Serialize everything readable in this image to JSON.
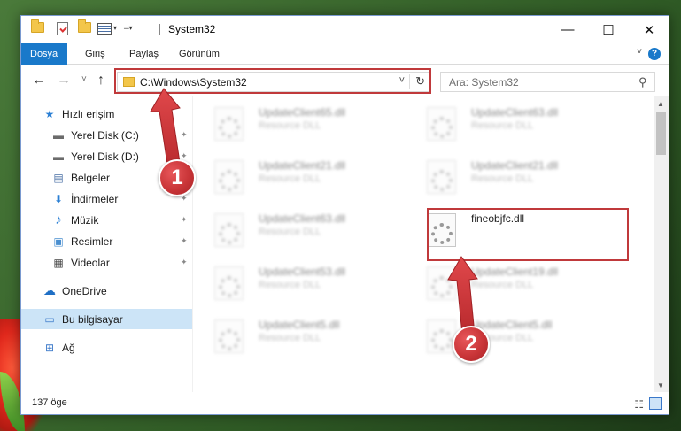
{
  "window": {
    "title": "System32",
    "minimize_glyph": "—",
    "maximize_glyph": "☐",
    "close_glyph": "✕"
  },
  "ribbon": {
    "tabs": [
      {
        "label": "Dosya",
        "active": true
      },
      {
        "label": "Giriş",
        "active": false
      },
      {
        "label": "Paylaş",
        "active": false
      },
      {
        "label": "Görünüm",
        "active": false
      }
    ],
    "help_glyph": "?"
  },
  "address": {
    "path": "C:\\Windows\\System32",
    "search_placeholder": "Ara: System32"
  },
  "sidebar": {
    "items": [
      {
        "label": "Hızlı erişim",
        "icon": "star-icon",
        "glyph": "★",
        "color": "#2a7fd4"
      },
      {
        "label": "Yerel Disk (C:)",
        "icon": "drive-icon",
        "glyph": "▬",
        "color": "#6b6b6b",
        "pinned": true
      },
      {
        "label": "Yerel Disk (D:)",
        "icon": "drive-icon",
        "glyph": "▬",
        "color": "#6b6b6b",
        "pinned": true
      },
      {
        "label": "Belgeler",
        "icon": "documents-icon",
        "glyph": "▤",
        "color": "#4a6fa5",
        "pinned": true
      },
      {
        "label": "İndirmeler",
        "icon": "downloads-icon",
        "glyph": "⬇",
        "color": "#2a7fd4",
        "pinned": true
      },
      {
        "label": "Müzik",
        "icon": "music-icon",
        "glyph": "♪",
        "color": "#2a7fd4",
        "pinned": true
      },
      {
        "label": "Resimler",
        "icon": "pictures-icon",
        "glyph": "▣",
        "color": "#4a8fd0",
        "pinned": true
      },
      {
        "label": "Videolar",
        "icon": "videos-icon",
        "glyph": "▦",
        "color": "#444444",
        "pinned": true
      },
      {
        "label": "OneDrive",
        "icon": "cloud-icon",
        "glyph": "☁",
        "color": "#1f6fc5"
      },
      {
        "label": "Bu bilgisayar",
        "icon": "computer-icon",
        "glyph": "▭",
        "color": "#3a78c9",
        "selected": true
      },
      {
        "label": "Ağ",
        "icon": "network-icon",
        "glyph": "⊞",
        "color": "#3a78c9"
      }
    ],
    "pin_glyph": "✦"
  },
  "files": [
    {
      "name": "UpdateClient65.dll",
      "type": "Resource DLL",
      "blurred": true
    },
    {
      "name": "UpdateClient63.dll",
      "type": "Resource DLL",
      "blurred": true
    },
    {
      "name": "UpdateClient21.dll",
      "type": "Resource DLL",
      "blurred": true
    },
    {
      "name": "UpdateClient21.dll",
      "type": "Resource DLL",
      "blurred": true
    },
    {
      "name": "UpdateClient63.dll",
      "type": "Resource DLL",
      "blurred": true
    },
    {
      "name": "fineobjfc.dll",
      "type": "",
      "blurred": false
    },
    {
      "name": "UpdateClient53.dll",
      "type": "Resource DLL",
      "blurred": true
    },
    {
      "name": "UpdateClient19.dll",
      "type": "Resource DLL",
      "blurred": true
    },
    {
      "name": "UpdateClient5.dll",
      "type": "Resource DLL",
      "blurred": true
    },
    {
      "name": "UpdateClient5.dll",
      "type": "Resource DLL",
      "blurred": true
    }
  ],
  "status": {
    "item_count": "137 öge"
  },
  "annotations": [
    {
      "number": "1"
    },
    {
      "number": "2"
    }
  ],
  "colors": {
    "accent": "#1979ca",
    "highlight": "#c0393b",
    "selection": "#cce4f7"
  }
}
